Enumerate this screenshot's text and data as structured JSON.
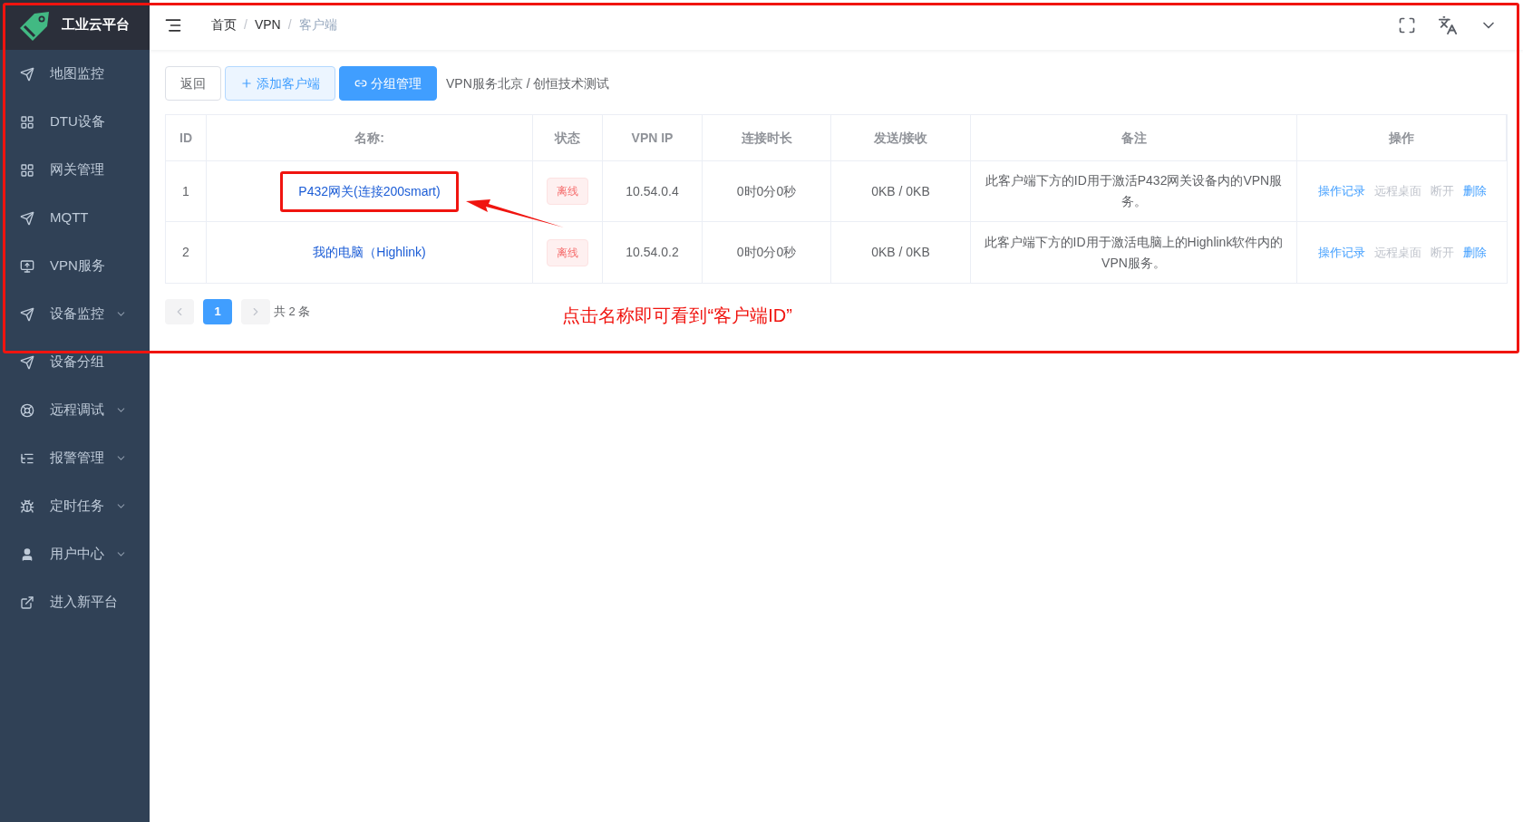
{
  "sidebar": {
    "logo_text": "工业云平台",
    "items": [
      {
        "label": "地图监控",
        "expandable": false
      },
      {
        "label": "DTU设备",
        "expandable": false
      },
      {
        "label": "网关管理",
        "expandable": false
      },
      {
        "label": "MQTT",
        "expandable": false
      },
      {
        "label": "VPN服务",
        "expandable": false
      },
      {
        "label": "设备监控",
        "expandable": true
      },
      {
        "label": "设备分组",
        "expandable": false
      },
      {
        "label": "远程调试",
        "expandable": true
      },
      {
        "label": "报警管理",
        "expandable": true
      },
      {
        "label": "定时任务",
        "expandable": true
      },
      {
        "label": "用户中心",
        "expandable": true
      },
      {
        "label": "进入新平台",
        "expandable": false
      }
    ]
  },
  "breadcrumb": [
    {
      "label": "首页",
      "current": false
    },
    {
      "label": "VPN",
      "current": false
    },
    {
      "label": "客户端",
      "current": true
    }
  ],
  "breadcrumb_separator": "/",
  "toolbar": {
    "buttons": [
      {
        "label": "返回",
        "kind": "plain"
      },
      {
        "label": "添加客户端",
        "kind": "light"
      },
      {
        "label": "分组管理",
        "kind": "primary"
      }
    ],
    "path": "VPN服务北京 / 创恒技术测试"
  },
  "table": {
    "columns": [
      "ID",
      "名称:",
      "状态",
      "VPN IP",
      "连接时长",
      "发送/接收",
      "备注",
      "操作"
    ],
    "rows": [
      {
        "id": "1",
        "name": "P432网关(连接200smart)",
        "status": "离线",
        "vpn_ip": "10.54.0.4",
        "duration": "0时0分0秒",
        "traffic": "0KB / 0KB",
        "note": "此客户端下方的ID用于激活P432网关设备内的VPN服务。",
        "highlighted": true,
        "actions": [
          {
            "label": "操作记录",
            "disabled": false
          },
          {
            "label": "远程桌面",
            "disabled": true
          },
          {
            "label": "断开",
            "disabled": true
          },
          {
            "label": "删除",
            "disabled": false
          }
        ]
      },
      {
        "id": "2",
        "name": "我的电脑（Highlink)",
        "status": "离线",
        "vpn_ip": "10.54.0.2",
        "duration": "0时0分0秒",
        "traffic": "0KB / 0KB",
        "note": "此客户端下方的ID用于激活电脑上的Highlink软件内的VPN服务。",
        "highlighted": false,
        "actions": [
          {
            "label": "操作记录",
            "disabled": false
          },
          {
            "label": "远程桌面",
            "disabled": true
          },
          {
            "label": "断开",
            "disabled": true
          },
          {
            "label": "删除",
            "disabled": false
          }
        ]
      }
    ]
  },
  "pagination": {
    "pages": [
      {
        "label": "1",
        "selected": true
      }
    ],
    "prev_disabled": true,
    "next_disabled": true,
    "total": "共 2 条"
  },
  "annotation": "点击名称即可看到“客户端ID”"
}
